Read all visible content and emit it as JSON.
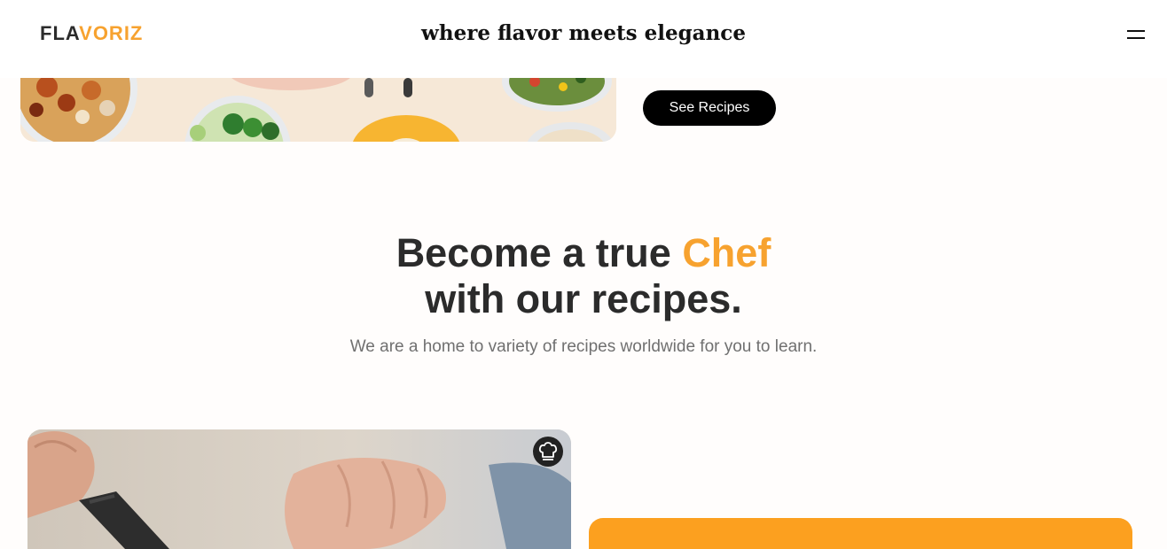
{
  "header": {
    "logo": {
      "part1": "FLA",
      "part2": "VORIZ"
    },
    "tagline": "where flavor meets elegance",
    "menu_icon": "hamburger-menu-icon"
  },
  "hero": {
    "cta_label": "See Recipes"
  },
  "intro": {
    "title_part1": "Become a true ",
    "title_highlight": "Chef",
    "title_line2": "with our recipes.",
    "subtitle": "We are a home to variety of recipes worldwide for you to learn."
  },
  "cards": {
    "badge_icon": "chef-hat-icon"
  },
  "colors": {
    "accent": "#f7a22f",
    "card_orange": "#fca01f",
    "button_bg": "#000000",
    "text_dark": "#2b2b2b",
    "text_muted": "#707070"
  }
}
